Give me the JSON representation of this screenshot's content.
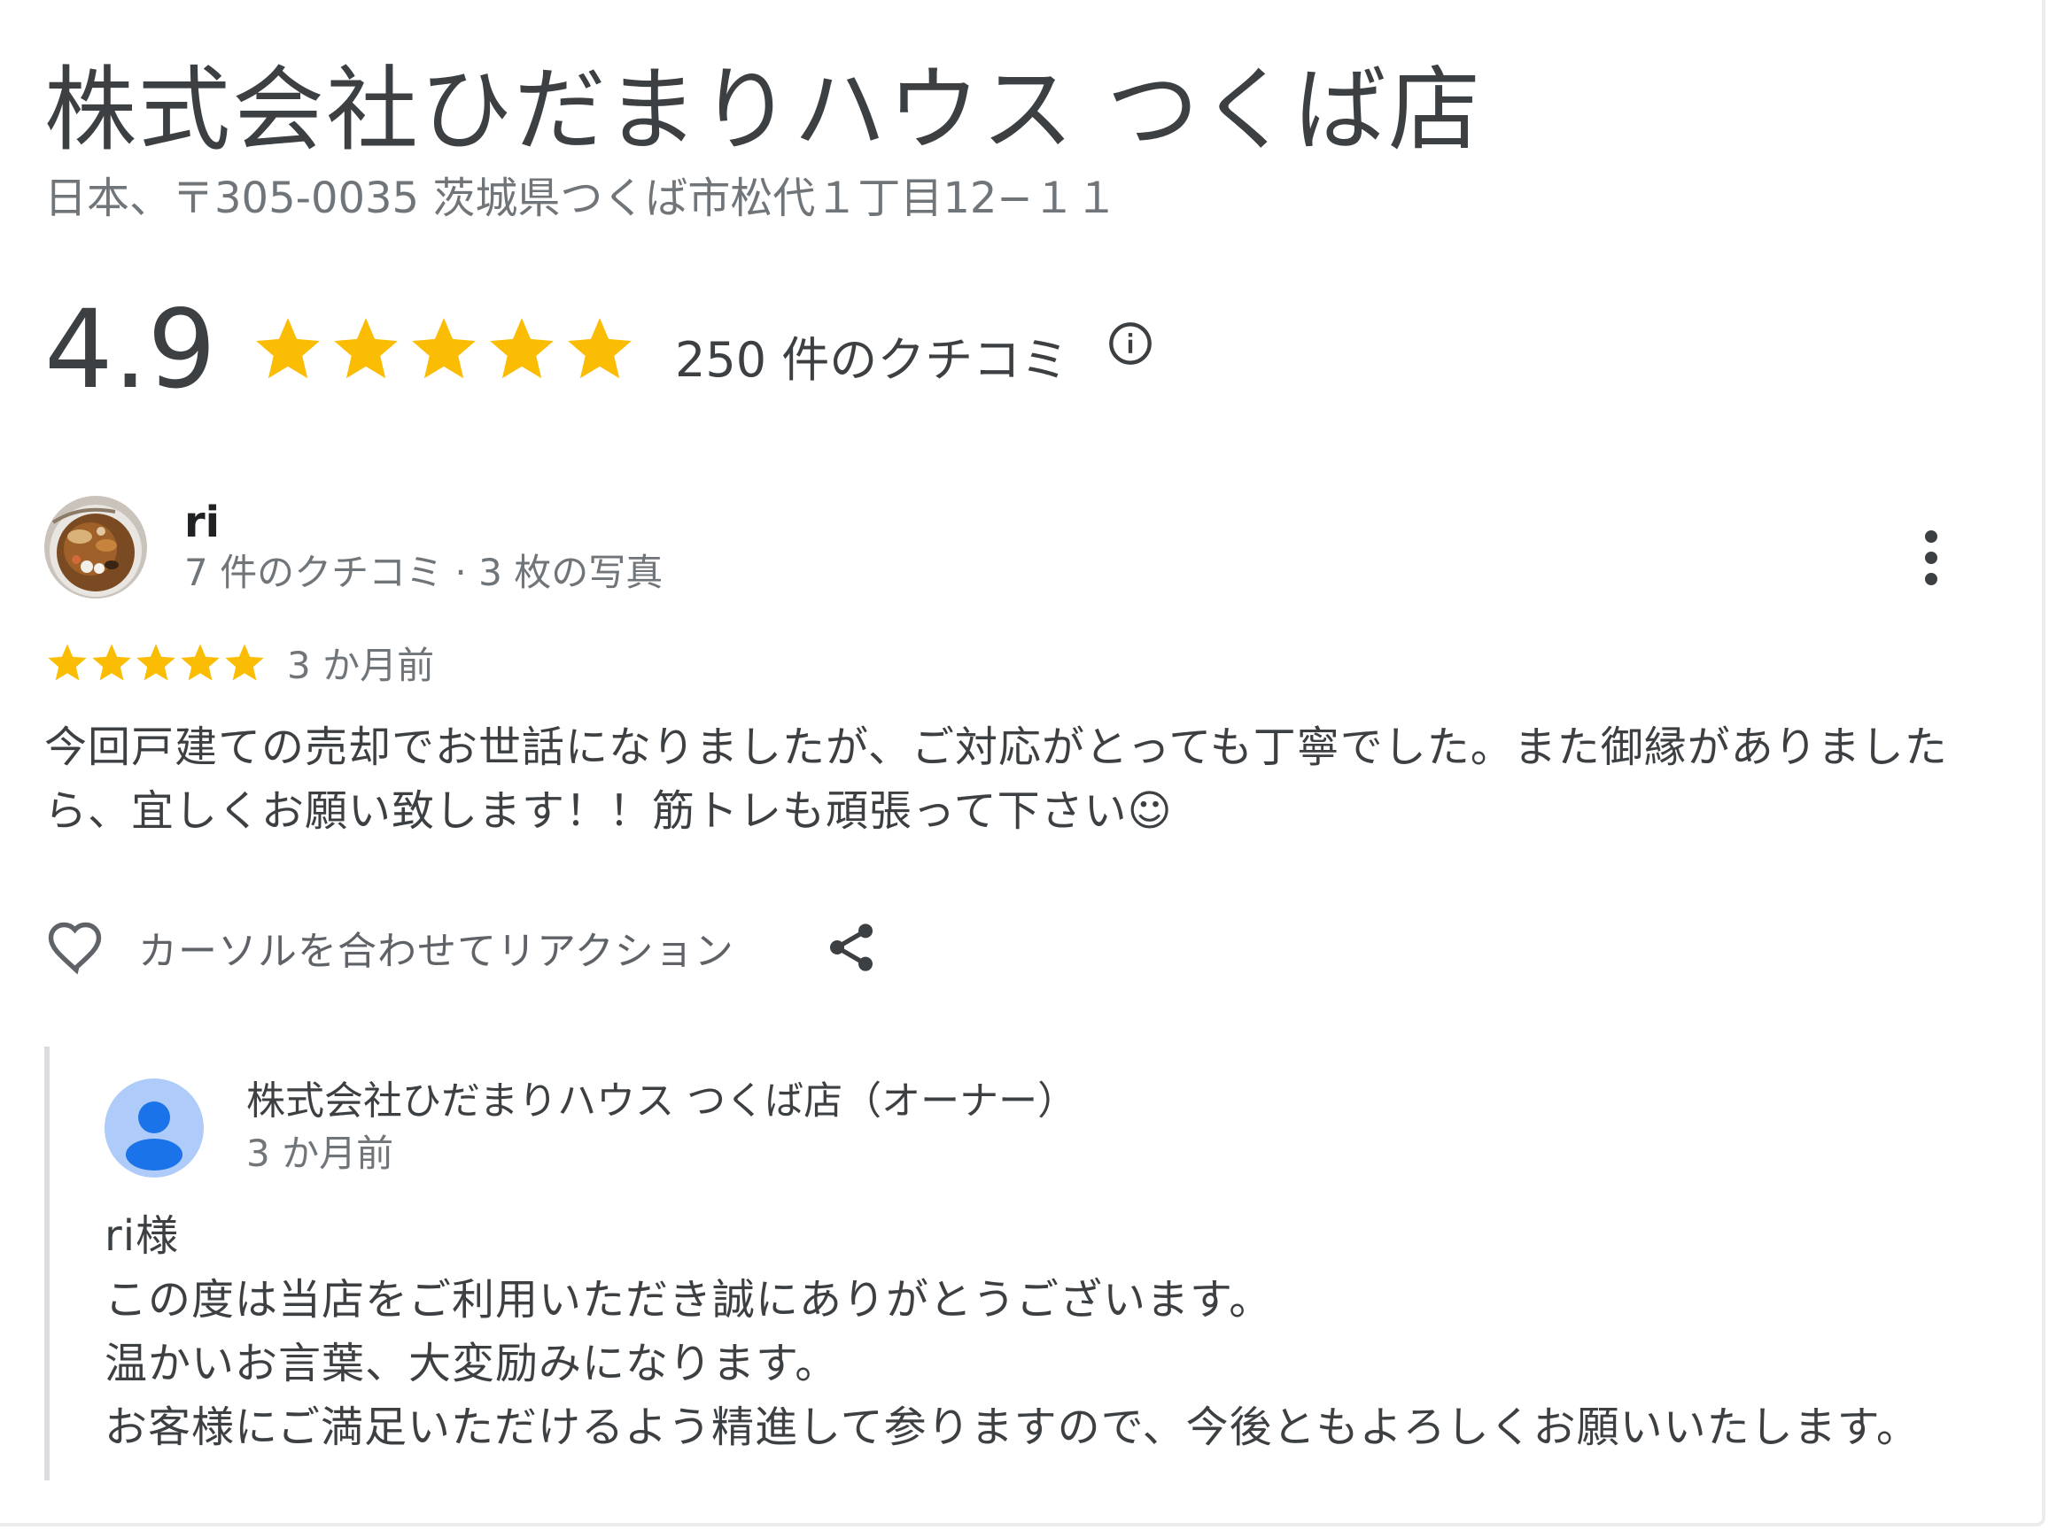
{
  "business": {
    "name": "株式会社ひだまりハウス つくば店",
    "address": "日本、〒305-0035 茨城県つくば市松代１丁目12−１１",
    "rating": "4.9",
    "rating_stars": 5,
    "review_count_label": "250 件のクチコミ",
    "star_color": "#fbbc04"
  },
  "review": {
    "reviewer_name": "ri",
    "reviewer_meta": "7 件のクチコミ · 3 枚の写真",
    "stars": 5,
    "date": "3 か月前",
    "text": "今回戸建ての売却でお世話になりましたが、ご対応がとっても丁寧でした。また御縁がありましたら、宜しくお願い致します！！筋トレも頑張って下さい☺",
    "react_label": "カーソルを合わせてリアクション",
    "icons": [
      "more-vert-icon",
      "heart-icon",
      "share-icon"
    ]
  },
  "owner_reply": {
    "name": "株式会社ひだまりハウス つくば店（オーナー）",
    "date": "3 か月前",
    "lines": [
      "ri様",
      "この度は当店をご利用いただき誠にありがとうございます。",
      "温かいお言葉、大変励みになります。",
      "お客様にご満足いただけるよう精進して参りますので、今後ともよろしくお願いいたします。"
    ],
    "avatar_color": "#1a73e8"
  }
}
